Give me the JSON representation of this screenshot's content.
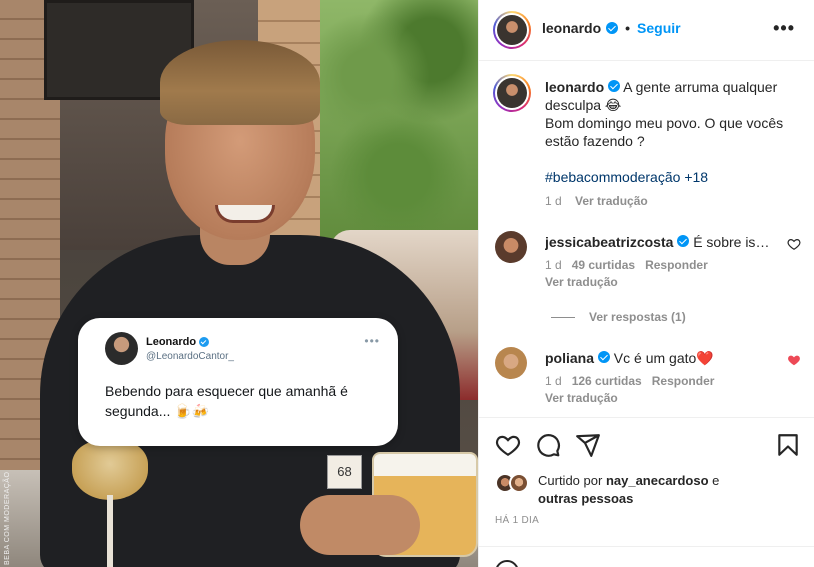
{
  "post": {
    "tweet": {
      "name": "Leonardo",
      "handle": "@LeonardoCantor_",
      "text": "Bebendo para esquecer que amanhã é segunda... 🍺🍻"
    },
    "watermark": "BEBA COM MODERAÇÃO",
    "plate": "68"
  },
  "header": {
    "username": "leonardo",
    "follow_label": "Seguir",
    "more_label": "•••"
  },
  "caption": {
    "username": "leonardo",
    "line1": "A gente arruma qualquer desculpa 😂",
    "line2": "Bom domingo meu povo. O que vocês estão fazendo ?",
    "hashtag": "#bebacommoderação",
    "hashtag_suffix": "+18",
    "time": "1 d",
    "translate": "Ver tradução"
  },
  "comments": [
    {
      "username": "jessicabeatrizcosta",
      "text": "É sobre isso...",
      "time": "1 d",
      "likes": "49 curtidas",
      "reply": "Responder",
      "translate": "Ver tradução",
      "liked": false
    },
    {
      "username": "poliana",
      "text": "Vc é um gato❤️",
      "time": "1 d",
      "likes": "126 curtidas",
      "reply": "Responder",
      "translate": "Ver tradução",
      "liked": true
    }
  ],
  "view_replies": "Ver respostas (1)",
  "liked_by": {
    "prefix": "Curtido por",
    "user": "nay_anecardoso",
    "joiner": "e",
    "others": "outras pessoas"
  },
  "time_ago": "HÁ 1 DIA",
  "colors": {
    "link_blue": "#0095f6",
    "heart_red": "#ed4956",
    "hashtag": "#00376b",
    "muted": "#8e8e8e"
  },
  "icons": [
    "heart-icon",
    "comment-icon",
    "share-icon",
    "bookmark-icon",
    "verified-badge-icon",
    "more-icon",
    "emoji-icon"
  ]
}
